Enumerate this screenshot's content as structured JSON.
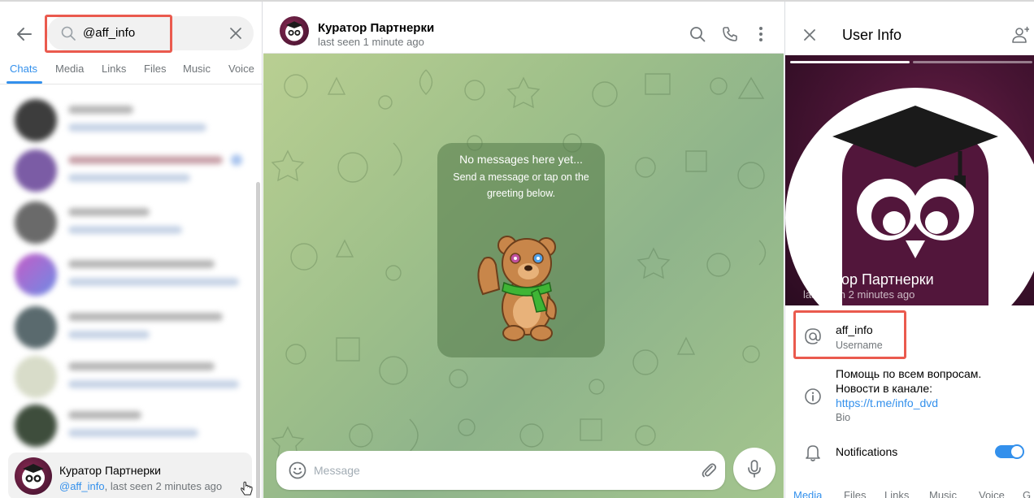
{
  "search": {
    "query": "@aff_info"
  },
  "left_tabs": [
    {
      "label": "Chats",
      "active": true
    },
    {
      "label": "Media",
      "active": false
    },
    {
      "label": "Links",
      "active": false
    },
    {
      "label": "Files",
      "active": false
    },
    {
      "label": "Music",
      "active": false
    },
    {
      "label": "Voice",
      "active": false
    }
  ],
  "search_result": {
    "name": "Куратор Партнерки",
    "username": "@aff_info",
    "status": ", last seen 2 minutes ago"
  },
  "chat": {
    "name": "Куратор Партнерки",
    "status": "last seen 1 minute ago",
    "empty_title": "No messages here yet...",
    "empty_text": "Send a message or tap on the greeting below.",
    "composer_placeholder": "Message"
  },
  "user_info": {
    "title": "User Info",
    "name": "Куратор Партнерки",
    "status": "last seen 2 minutes ago",
    "username": "aff_info",
    "username_label": "Username",
    "bio_line1": "Помощь по всем вопросам.",
    "bio_line2": "Новости в канале:",
    "bio_link": "https://t.me/info_dvd",
    "bio_label": "Bio",
    "notifications_label": "Notifications",
    "notifications_on": true,
    "tabs": [
      {
        "label": "Media",
        "active": true
      },
      {
        "label": "Files",
        "active": false
      },
      {
        "label": "Links",
        "active": false
      },
      {
        "label": "Music",
        "active": false
      },
      {
        "label": "Voice",
        "active": false
      },
      {
        "label": "G",
        "active": false
      }
    ]
  },
  "colors": {
    "accent": "#3390ec",
    "highlight_box": "#ea5a4e",
    "secondary_text": "#707579",
    "avatar_bg": "#5a1a3f"
  },
  "icons": [
    "back-arrow-icon",
    "search-icon",
    "close-icon",
    "phone-icon",
    "more-vertical-icon",
    "emoji-icon",
    "attach-icon",
    "microphone-icon",
    "add-user-icon",
    "at-sign-icon",
    "info-icon",
    "bell-icon"
  ]
}
